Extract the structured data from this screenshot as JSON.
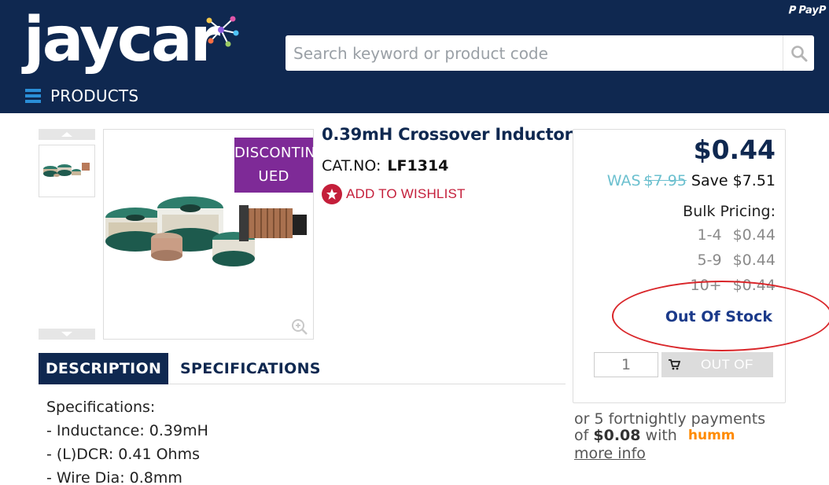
{
  "header": {
    "logo_text": "jaycar",
    "search_placeholder": "Search keyword or product code",
    "paypal_label": "PayP",
    "menu_label": "PRODUCTS"
  },
  "product": {
    "title": "0.39mH Crossover Inductor",
    "catno_label": "CAT.NO:",
    "catno": "LF1314",
    "wishlist_label": "ADD TO WISHLIST",
    "badge_line1": "DISCONTIN",
    "badge_line2": "UED"
  },
  "price": {
    "current": "$0.44",
    "was_label": "WAS",
    "was_price": "$7.95",
    "save": "Save $7.51",
    "bulk_title": "Bulk Pricing:",
    "bulk": [
      {
        "qty": "1-4",
        "price": "$0.44"
      },
      {
        "qty": "5-9",
        "price": "$0.44"
      },
      {
        "qty": "10+",
        "price": "$0.44"
      }
    ],
    "stock_status": "Out Of Stock",
    "quantity": "1",
    "button_label": "OUT OF"
  },
  "humm": {
    "line1": "or 5 fortnightly payments",
    "line2_prefix": "of",
    "amount": "$0.08",
    "line2_suffix": "with",
    "logo": "humm",
    "more_info": "more info"
  },
  "tabs": [
    {
      "label": "DESCRIPTION",
      "active": true
    },
    {
      "label": "SPECIFICATIONS",
      "active": false
    }
  ],
  "description": [
    "Specifications:",
    "- Inductance: 0.39mH",
    "- (L)DCR: 0.41 Ohms",
    "- Wire Dia: 0.8mm"
  ],
  "colors": {
    "navy": "#0f2850",
    "badge_purple": "#7e2a97",
    "wishlist_red": "#c41e3a",
    "was_teal": "#6cc0cf",
    "annotation_red": "#d9262a",
    "humm_orange": "#ff8a00"
  }
}
